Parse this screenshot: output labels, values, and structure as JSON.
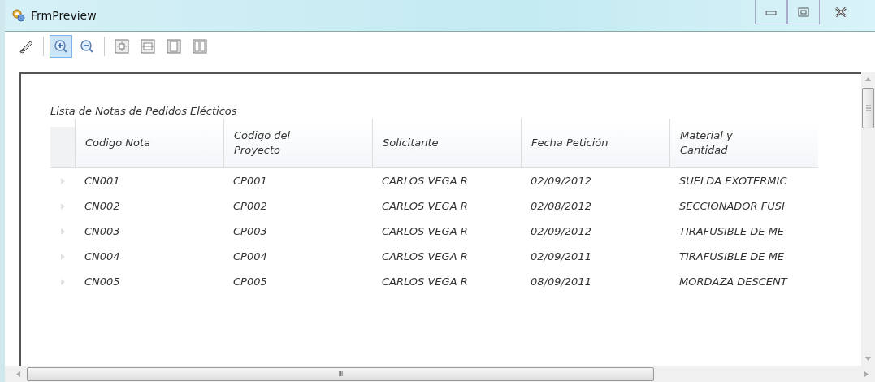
{
  "window": {
    "title": "FrmPreview"
  },
  "toolbar": {
    "buttons": [
      {
        "selected": false
      },
      {
        "selected": true
      },
      {
        "selected": false
      },
      {
        "selected": false
      },
      {
        "selected": false
      },
      {
        "selected": false
      },
      {
        "selected": false
      }
    ]
  },
  "report": {
    "title": "Lista de Notas de Pedidos Elécticos",
    "columns": [
      "Codigo Nota",
      "Codigo del Proyecto",
      "Solicitante",
      "Fecha Petición",
      "Material y Cantidad"
    ],
    "rows": [
      [
        "CN001",
        "CP001",
        "CARLOS VEGA R",
        "02/09/2012",
        "SUELDA EXOTERMIC"
      ],
      [
        "CN002",
        "CP002",
        "CARLOS VEGA R",
        "02/08/2012",
        "SECCIONADOR FUSI"
      ],
      [
        "CN003",
        "CP003",
        "CARLOS VEGA R",
        "02/09/2012",
        "TIRAFUSIBLE DE ME"
      ],
      [
        "CN004",
        "CP004",
        "CARLOS VEGA R",
        "02/09/2011",
        "TIRAFUSIBLE DE ME"
      ],
      [
        "CN005",
        "CP005",
        "CARLOS VEGA R",
        "08/09/2011",
        "MORDAZA DESCENT"
      ]
    ]
  },
  "scrollbar_grip": "III"
}
